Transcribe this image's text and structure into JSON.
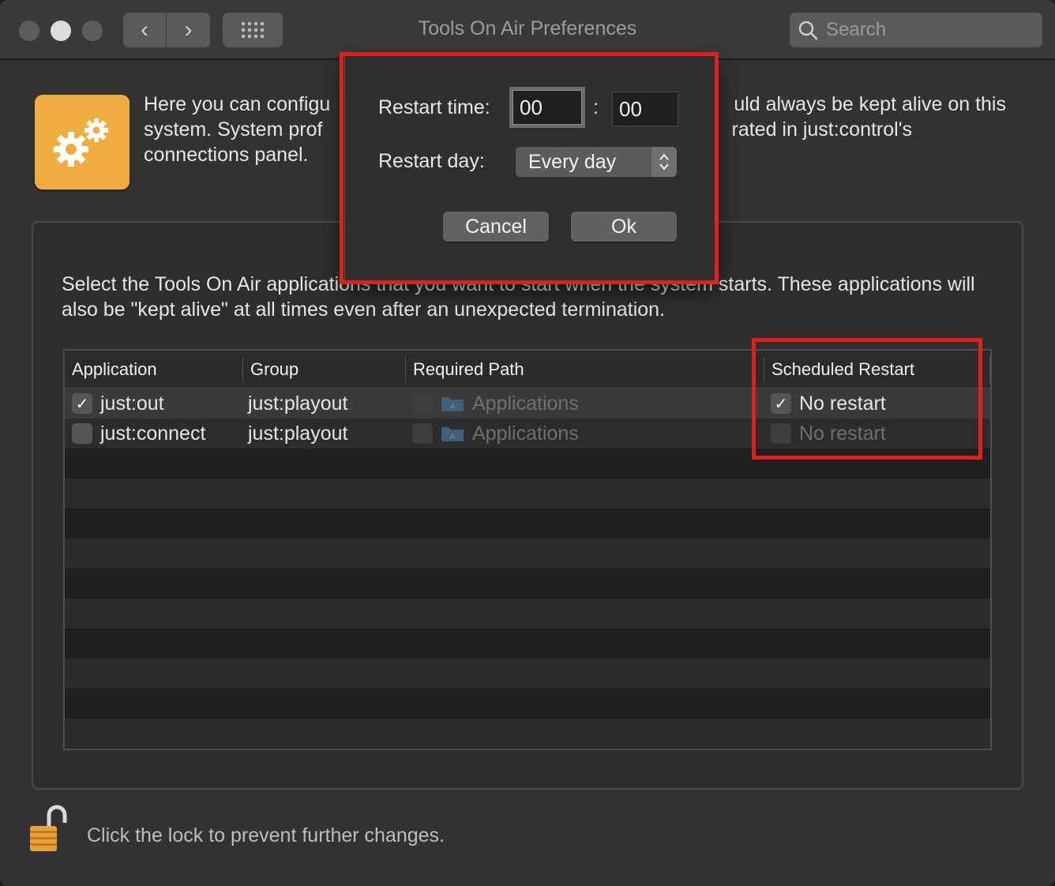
{
  "window": {
    "title": "Tools On Air Preferences",
    "search_placeholder": "Search",
    "back_glyph": "‹",
    "forward_glyph": "›"
  },
  "icons": {
    "prefs": "gears-icon",
    "search": "magnifier-icon",
    "lock": "padlock-open-icon",
    "folder": "applications-folder-icon"
  },
  "colors": {
    "accent_orange": "#f0ad3f",
    "annotation_red": "#e0201b",
    "window_bg": "#323232"
  },
  "intro": {
    "line1_left": "Here you can configu",
    "line1_right": "uld always be kept alive on this",
    "line2_left": "system. System prof",
    "line2_right": "rated in just:control's",
    "line3_left": "connections panel."
  },
  "description": "Select the Tools On Air applications that you want to start when the system starts. These applications will also be \"kept alive\" at all times even after an unexpected termination.",
  "table": {
    "columns": [
      "Application",
      "Group",
      "Required Path",
      "Scheduled Restart"
    ],
    "rows": [
      {
        "checked": true,
        "application": "just:out",
        "group": "just:playout",
        "path_checked": false,
        "path": "Applications",
        "restart_checked": true,
        "restart": "No restart"
      },
      {
        "checked": false,
        "application": "just:connect",
        "group": "just:playout",
        "path_checked": false,
        "path": "Applications",
        "restart_checked": false,
        "restart": "No restart"
      }
    ]
  },
  "dialog": {
    "restart_time_label": "Restart time:",
    "hours": "00",
    "separator": ":",
    "minutes": "00",
    "restart_day_label": "Restart day:",
    "restart_day_value": "Every day",
    "cancel_label": "Cancel",
    "ok_label": "Ok"
  },
  "footer": {
    "lock_text": "Click the lock to prevent further changes."
  }
}
